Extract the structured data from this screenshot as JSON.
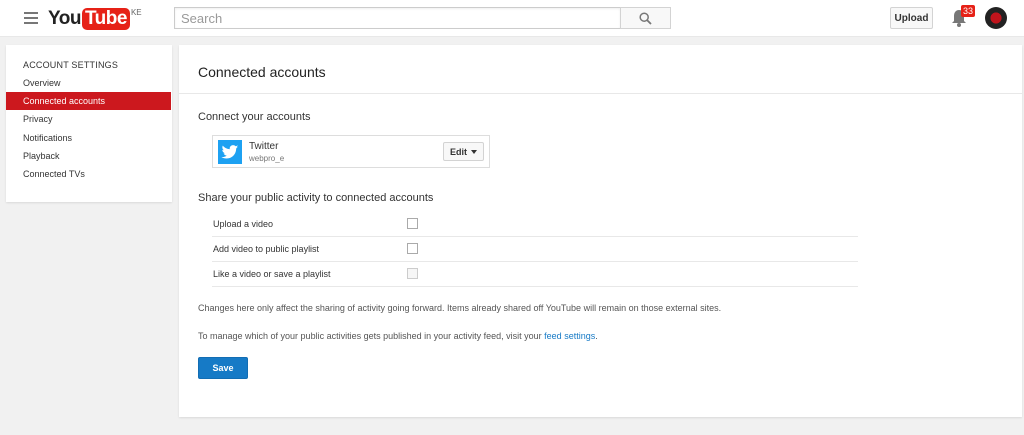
{
  "header": {
    "logo_you": "You",
    "logo_tube": "Tube",
    "logo_country": "KE",
    "search_placeholder": "Search",
    "upload_label": "Upload",
    "notification_count": "33",
    "brand_color": "#e62117"
  },
  "sidebar": {
    "heading": "ACCOUNT SETTINGS",
    "items": [
      {
        "label": "Overview",
        "active": false
      },
      {
        "label": "Connected accounts",
        "active": true
      },
      {
        "label": "Privacy",
        "active": false
      },
      {
        "label": "Notifications",
        "active": false
      },
      {
        "label": "Playback",
        "active": false
      },
      {
        "label": "Connected TVs",
        "active": false
      }
    ],
    "active_color": "#cc181e"
  },
  "main": {
    "title": "Connected accounts",
    "connect_heading": "Connect your accounts",
    "account": {
      "icon": "twitter-icon",
      "name": "Twitter",
      "handle": "webpro_e",
      "edit_label": "Edit"
    },
    "share_heading": "Share your public activity to connected accounts",
    "options": [
      {
        "label": "Upload a video",
        "checked": false,
        "disabled": false
      },
      {
        "label": "Add video to public playlist",
        "checked": false,
        "disabled": false
      },
      {
        "label": "Like a video or save a playlist",
        "checked": false,
        "disabled": true
      }
    ],
    "note_1": "Changes here only affect the sharing of activity going forward. Items already shared off YouTube will remain on those external sites.",
    "note_2_prefix": "To manage which of your public activities gets published in your activity feed, visit your ",
    "note_2_link": "feed settings",
    "note_2_suffix": ".",
    "save_label": "Save",
    "link_color": "#167ac6"
  }
}
